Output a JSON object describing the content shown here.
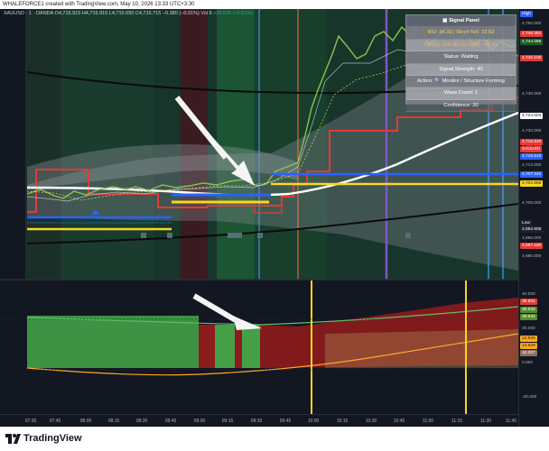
{
  "header": {
    "caption": "WHALEFORCE1 created with TradingView.com, May 10, 2026 13:33 UTC+3:30"
  },
  "legend": {
    "symbol": "XAUUSD · 1 · OANDA",
    "ohlc": "O4,715.915  H4,715.915  L4,715.650  C4,715.715  −0.380 (−0.01%)",
    "vol": "Vol 9",
    "change": "+28.535 (+0.61%)"
  },
  "signal_panel": {
    "title": "Signal Panel",
    "rsi_stoch": "RSI: 34.33 | Stoch %K: 22.62",
    "cci": "CCI(5): 110.38 | CCI(20): -42.61",
    "status": "Status: Waiting",
    "strength": "Signal Strength: 40",
    "action": "Action: 🔍 Monitor / Structure Forming",
    "wave": "Wave Count: 1",
    "confidence": "Confidence: 30"
  },
  "price_axis": {
    "ticks": [
      "4,750.000",
      "4,740.000",
      "4,730.000",
      "4,720.000",
      "4,712.000",
      "4,700.000",
      "4,690.000",
      "4,680.000"
    ],
    "tags": [
      {
        "text": "High",
        "color": "#2962ff"
      },
      {
        "text": "4,746.381",
        "color": "#e53935"
      },
      {
        "text": "4,744.085",
        "color": "#1b5e20"
      },
      {
        "text": "4,740.105",
        "color": "#e53935"
      },
      {
        "text": "4,724.004",
        "color": "#ffffff"
      },
      {
        "text": "4,716.920",
        "color": "#e53935"
      },
      {
        "text": "XAUUSD",
        "color": "#e53935"
      },
      {
        "text": "4,715.510",
        "color": "#2962ff"
      },
      {
        "text": "4,707.310",
        "color": "#2962ff"
      },
      {
        "text": "4,704.965",
        "color": "#f9d71c"
      },
      {
        "text": "Low",
        "color": "#1e222d"
      },
      {
        "text": "4,692.505",
        "color": "#1e222d"
      },
      {
        "text": "4,687.180",
        "color": "#e53935"
      }
    ]
  },
  "osc_axis": {
    "ticks": [
      "40.000",
      "20.000",
      "0.000",
      "-20.000"
    ],
    "tags": [
      {
        "text": "38.601",
        "color": "#e53935"
      },
      {
        "text": "30.632",
        "color": "#558b2f"
      },
      {
        "text": "30.632",
        "color": "#558b2f"
      },
      {
        "text": "13.929",
        "color": "#f9a825"
      },
      {
        "text": "13.929",
        "color": "#f9a825"
      },
      {
        "text": "10.207",
        "color": "#8d6e63"
      }
    ]
  },
  "time_axis": {
    "labels": [
      "07:30",
      "07:45",
      "08:00",
      "08:15",
      "08:30",
      "08:45",
      "09:00",
      "09:15",
      "09:30",
      "09:45",
      "10:00",
      "10:15",
      "10:30",
      "10:45",
      "11:00",
      "11:15",
      "11:30",
      "11:45"
    ]
  },
  "footer": {
    "brand": "TradingView"
  }
}
